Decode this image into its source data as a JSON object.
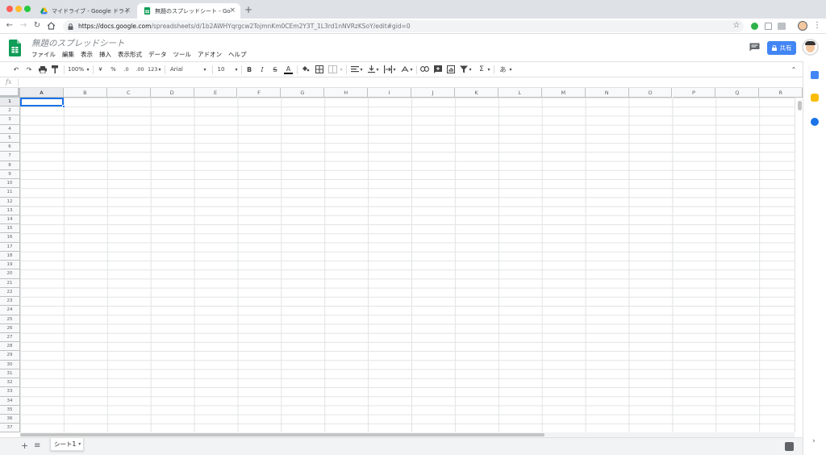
{
  "browser": {
    "tabs": [
      {
        "title": "マイドライブ - Google ドライブ",
        "active": false,
        "icon": "google-drive-icon"
      },
      {
        "title": "無題のスプレッドシート - Google",
        "active": true,
        "icon": "google-sheets-icon"
      }
    ],
    "close_glyph": "×",
    "new_tab_glyph": "+",
    "url_host": "https://docs.google.com",
    "url_path": "/spreadsheets/d/1b2AWHYqrgcw2TojmnKm0CEm2Y3T_1L3rd1nNVRzKSoY/edit#gid=0"
  },
  "sheets": {
    "doc_title": "無題のスプレッドシート",
    "menu": [
      "ファイル",
      "編集",
      "表示",
      "挿入",
      "表示形式",
      "データ",
      "ツール",
      "アドオン",
      "ヘルプ"
    ],
    "share_label": "共有",
    "toolbar": {
      "zoom": "100%",
      "currency": "¥",
      "percent": "%",
      "decrease_decimal": ".0",
      "increase_decimal": ".00",
      "more_formats": "123",
      "font": "Arial",
      "font_size": "10",
      "bold": "B",
      "italic": "I",
      "strikethrough": "S",
      "text_color": "A",
      "input_tools": "あ",
      "function": "Σ"
    },
    "fx_label": "fx",
    "columns": [
      "A",
      "B",
      "C",
      "D",
      "E",
      "F",
      "G",
      "H",
      "I",
      "J",
      "K",
      "L",
      "M",
      "N",
      "O",
      "P",
      "Q",
      "R"
    ],
    "rows": [
      "1",
      "2",
      "3",
      "4",
      "5",
      "6",
      "7",
      "8",
      "9",
      "10",
      "11",
      "12",
      "13",
      "14",
      "15",
      "16",
      "17",
      "18",
      "19",
      "20",
      "21",
      "22",
      "23",
      "24",
      "25",
      "26",
      "27",
      "28",
      "29",
      "30",
      "31",
      "32",
      "33",
      "34",
      "35",
      "36",
      "37"
    ],
    "active_cell": "A1",
    "sheet_tab": "シート1",
    "accent_color": "#1a73e8",
    "share_color": "#4285f4"
  }
}
